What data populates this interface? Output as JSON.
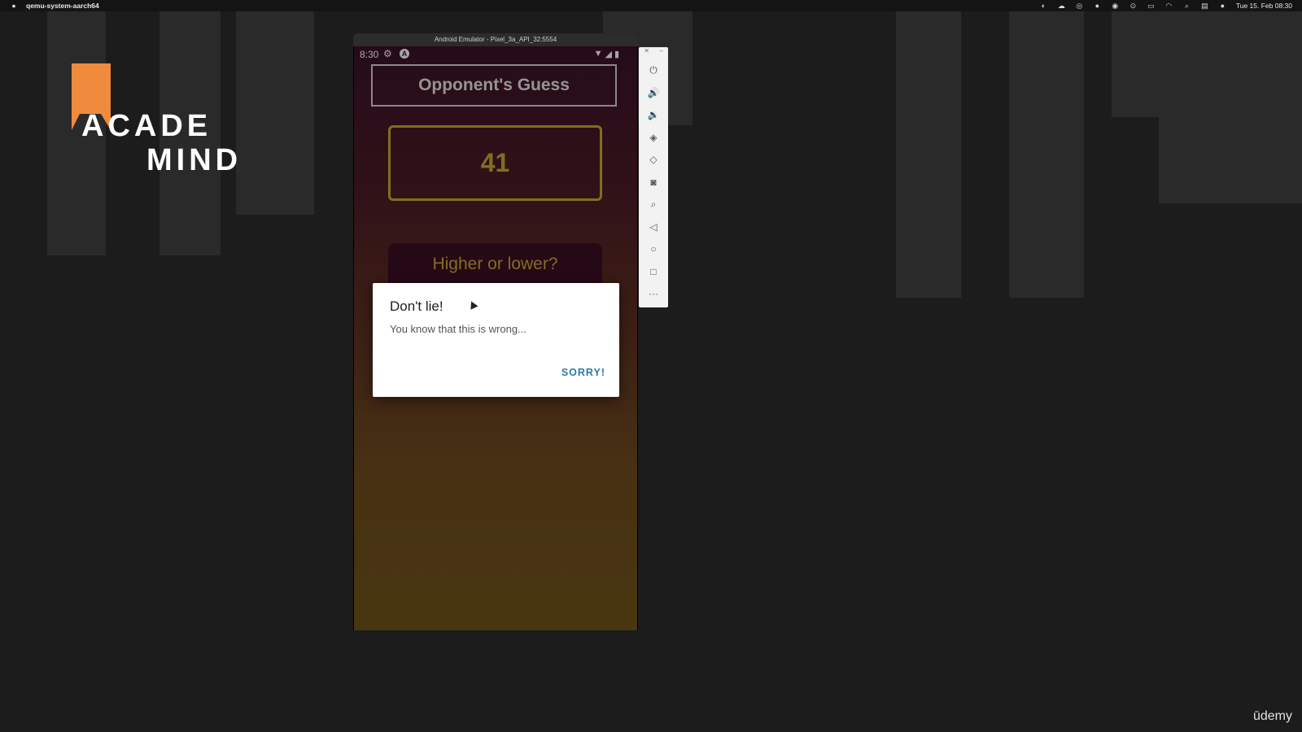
{
  "menubar": {
    "app_name": "qemu-system-aarch64",
    "datetime": "Tue 15. Feb 08:30",
    "icons": [
      "apple-icon",
      "app-icon-1",
      "app-icon-2",
      "app-icon-3",
      "app-icon-4",
      "app-icon-5",
      "app-icon-6",
      "battery-icon",
      "wifi-icon",
      "search-icon",
      "control-center-icon",
      "siri-icon"
    ]
  },
  "logo": {
    "line1": "ACADE",
    "line2": "MIND",
    "accent": "#f08a3c"
  },
  "emulator": {
    "window_title": "Android Emulator - Pixel_3a_API_32:5554",
    "statusbar": {
      "time": "8:30"
    },
    "app": {
      "title": "Opponent's Guess",
      "guess": "41",
      "prompt": "Higher or lower?"
    },
    "dialog": {
      "title": "Don't lie!",
      "message": "You know that this is wrong...",
      "button": "SORRY!"
    },
    "toolbar": [
      "power-icon",
      "volume-up-icon",
      "volume-down-icon",
      "rotate-left-icon",
      "rotate-right-icon",
      "camera-icon",
      "zoom-icon",
      "back-icon",
      "home-icon",
      "overview-icon",
      "more-icon"
    ]
  },
  "watermark": "ūdemy",
  "colors": {
    "desktop_bg": "#1c1c1c",
    "guess_accent": "#c9a830",
    "dialog_button": "#2c7aa3"
  }
}
